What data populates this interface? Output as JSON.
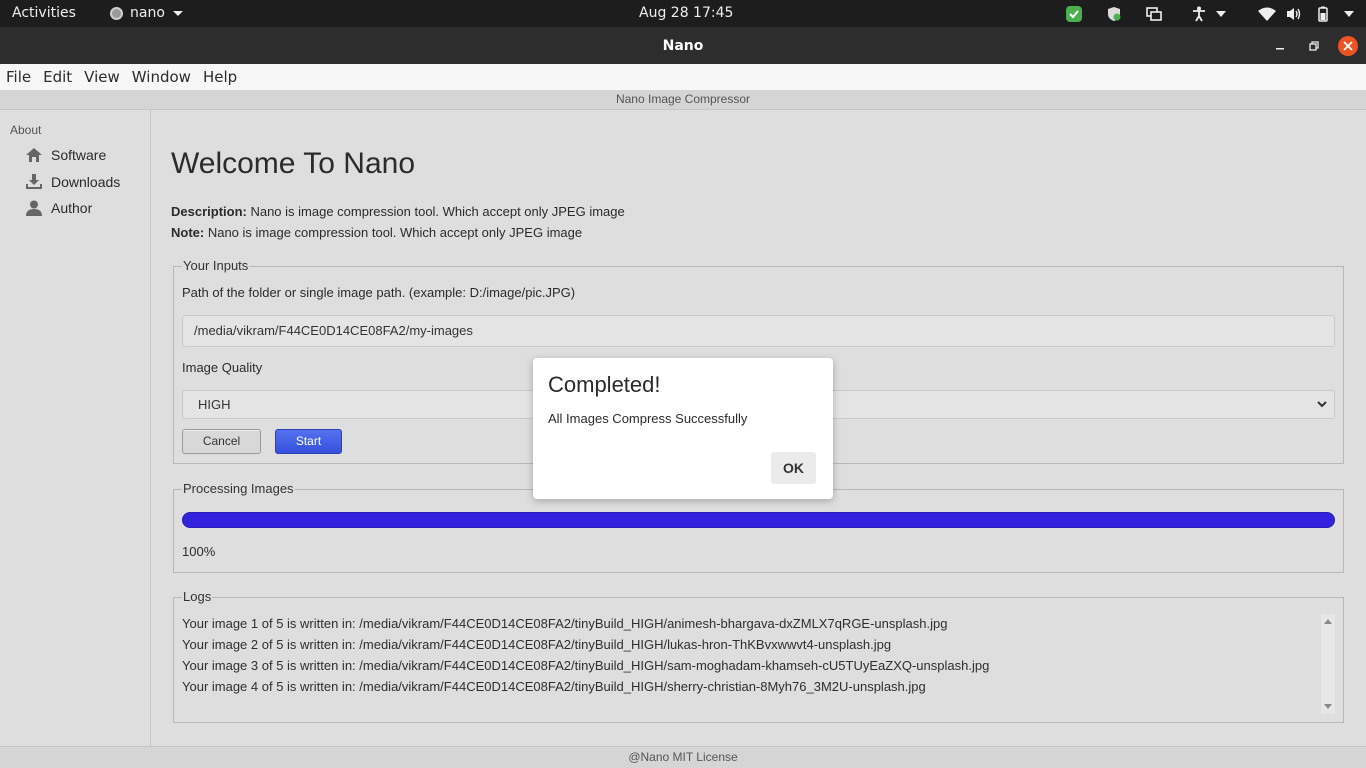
{
  "topbar": {
    "activities": "Activities",
    "app_name": "nano",
    "clock": "Aug 28  17:45",
    "tray_icons": [
      "app-indicator-check-icon",
      "shield-icon",
      "screen-share-icon",
      "accessibility-icon",
      "wifi-icon",
      "volume-icon",
      "battery-icon"
    ]
  },
  "window": {
    "title": "Nano"
  },
  "menubar": {
    "items": [
      "File",
      "Edit",
      "View",
      "Window",
      "Help"
    ]
  },
  "app_header": "Nano Image Compressor",
  "sidebar": {
    "heading": "About",
    "items": [
      {
        "label": "Software",
        "icon": "home-icon"
      },
      {
        "label": "Downloads",
        "icon": "download-icon"
      },
      {
        "label": "Author",
        "icon": "user-icon"
      }
    ]
  },
  "main": {
    "title": "Welcome To Nano",
    "description_label": "Description:",
    "description": " Nano is image compression tool. Which accept only JPEG image",
    "note_label": "Note:",
    "note": " Nano is image compression tool. Which accept only JPEG image",
    "inputs": {
      "legend": "Your Inputs",
      "path_label": "Path of the folder or single image path. (example: D:/image/pic.JPG)",
      "path_value": "/media/vikram/F44CE0D14CE08FA2/my-images",
      "quality_label": "Image Quality",
      "quality_value": "HIGH",
      "cancel_label": "Cancel",
      "start_label": "Start"
    },
    "processing": {
      "legend": "Processing Images",
      "progress_fraction": 1.0,
      "progress_text": "100%"
    },
    "logs": {
      "legend": "Logs",
      "lines": [
        "Your image 1 of 5 is written in: /media/vikram/F44CE0D14CE08FA2/tinyBuild_HIGH/animesh-bhargava-dxZMLX7qRGE-unsplash.jpg",
        "Your image 2 of 5 is written in: /media/vikram/F44CE0D14CE08FA2/tinyBuild_HIGH/lukas-hron-ThKBvxwwvt4-unsplash.jpg",
        "Your image 3 of 5 is written in: /media/vikram/F44CE0D14CE08FA2/tinyBuild_HIGH/sam-moghadam-khamseh-cU5TUyEaZXQ-unsplash.jpg",
        "Your image 4 of 5 is written in: /media/vikram/F44CE0D14CE08FA2/tinyBuild_HIGH/sherry-christian-8Myh76_3M2U-unsplash.jpg"
      ]
    }
  },
  "footer": "@Nano MIT License",
  "dialog": {
    "title": "Completed!",
    "message": "All Images Compress Successfully",
    "ok_label": "OK"
  },
  "colors": {
    "accent": "#3322dd",
    "start_button": "#3d5ae6",
    "close_button": "#e95420",
    "topbar": "#1d1d1d",
    "titlebar": "#2d2d2d"
  }
}
